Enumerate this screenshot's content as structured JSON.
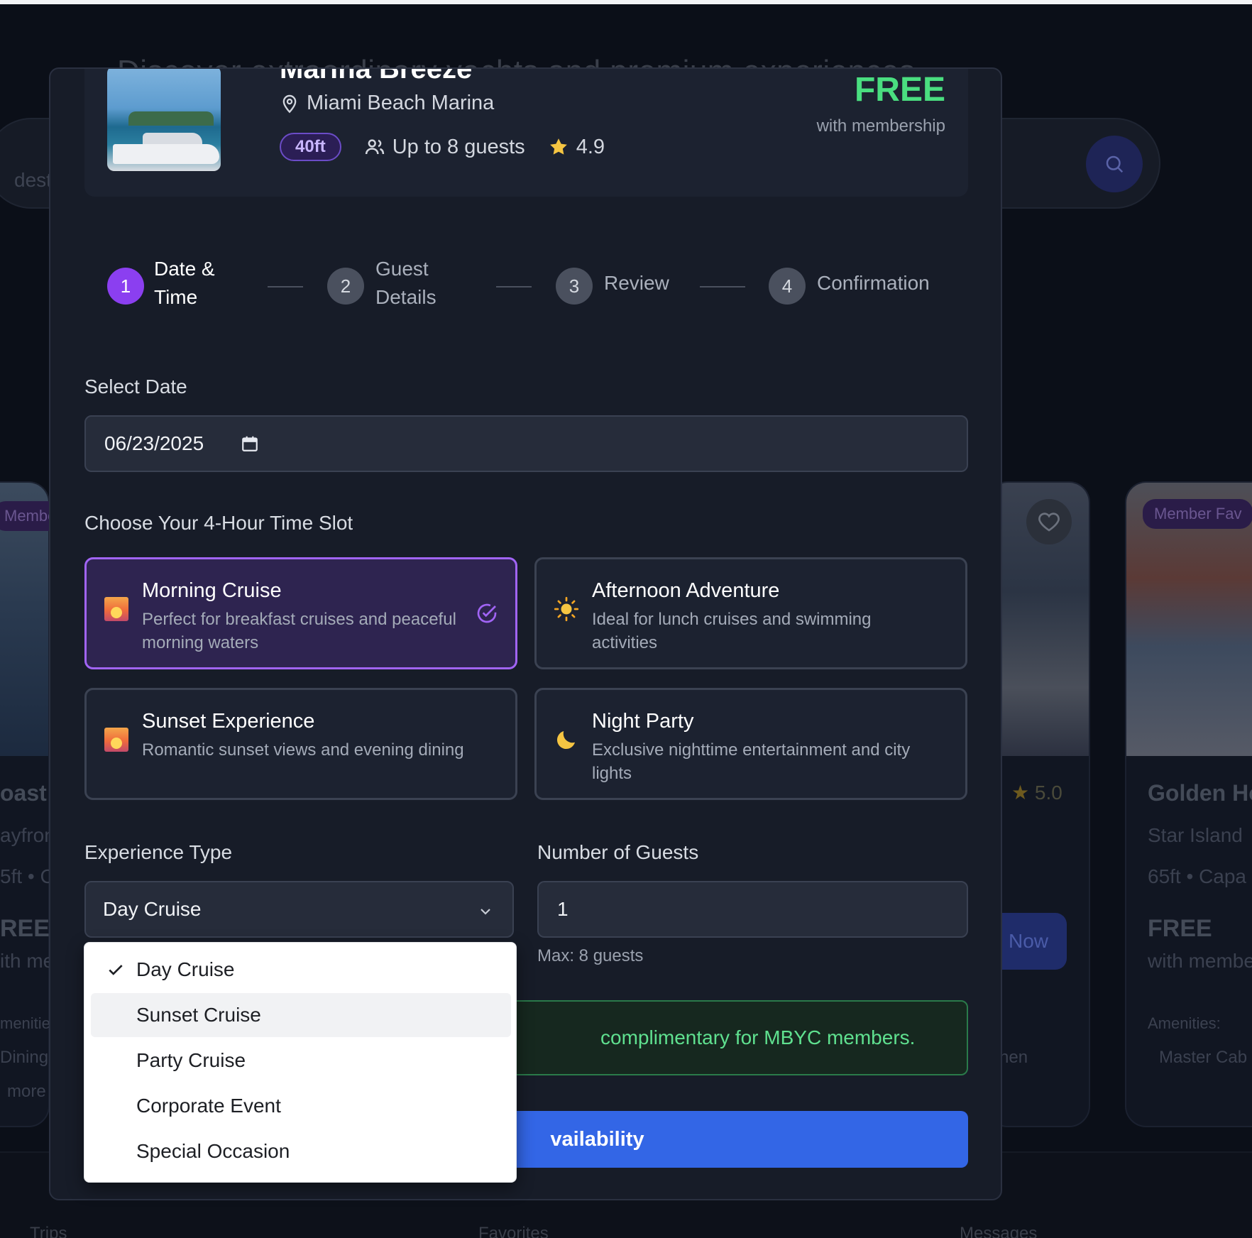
{
  "background": {
    "hero_text": "Discover extraordinary yachts and premium experiences",
    "search_placeholder": "destin",
    "card_left": {
      "tag": "Membe",
      "name": "oast",
      "location": "ayfron",
      "meta": "5ft • C",
      "price": "REE",
      "price_sub": "ith me",
      "amenities": "menitie",
      "amenity": "Dining",
      "more": "more"
    },
    "card_mid": {
      "rating": "5.0",
      "book": "Now",
      "amenity": "hen"
    },
    "card_right": {
      "tag": "Member Fav",
      "name": "Golden Ho",
      "location": "Star Island",
      "meta": "65ft • Capa",
      "price": "FREE",
      "price_sub": "with membe",
      "amenities": "Amenities:",
      "amenity": "Master Cab"
    },
    "nav": {
      "trips": "Trips",
      "favorites": "Favorites",
      "messages": "Messages"
    }
  },
  "yacht": {
    "name": "Marina Breeze",
    "location": "Miami Beach Marina",
    "size": "40ft",
    "capacity": "Up to 8 guests",
    "rating": "4.9",
    "price": "FREE",
    "price_note": "with membership"
  },
  "steps": [
    {
      "number": "1",
      "label_line1": "Date &",
      "label_line2": "Time"
    },
    {
      "number": "2",
      "label_line1": "Guest",
      "label_line2": "Details"
    },
    {
      "number": "3",
      "label": "Review"
    },
    {
      "number": "4",
      "label": "Confirmation"
    }
  ],
  "date_section": {
    "label": "Select Date",
    "value": "06/23/2025"
  },
  "time_slot_section": {
    "label": "Choose Your 4-Hour Time Slot",
    "slots": [
      {
        "title": "Morning Cruise",
        "description": "Perfect for breakfast cruises and peaceful morning waters",
        "icon": "sunrise-icon",
        "emoji": "🌅",
        "selected": true
      },
      {
        "title": "Afternoon Adventure",
        "description": "Ideal for lunch cruises and swimming activities",
        "icon": "sun-icon",
        "emoji": "☀️",
        "selected": false
      },
      {
        "title": "Sunset Experience",
        "description": "Romantic sunset views and evening dining",
        "icon": "sunset-icon",
        "emoji": "🌅",
        "selected": false
      },
      {
        "title": "Night Party",
        "description": "Exclusive nighttime entertainment and city lights",
        "icon": "moon-icon",
        "emoji": "🌙",
        "selected": false
      }
    ]
  },
  "experience_type": {
    "label": "Experience Type",
    "selected": "Day Cruise",
    "options": [
      "Day Cruise",
      "Sunset Cruise",
      "Party Cruise",
      "Corporate Event",
      "Special Occasion"
    ],
    "hovered_option": "Sunset Cruise"
  },
  "guests": {
    "label": "Number of Guests",
    "value": "1",
    "hint": "Max: 8 guests"
  },
  "notice": {
    "text": "complimentary for MBYC members."
  },
  "cta": {
    "label": "vailability"
  },
  "colors": {
    "accent": "#8b3ff0",
    "free_green": "#4ade80",
    "cta_blue": "#3366e6",
    "modal_bg": "#171c28"
  }
}
